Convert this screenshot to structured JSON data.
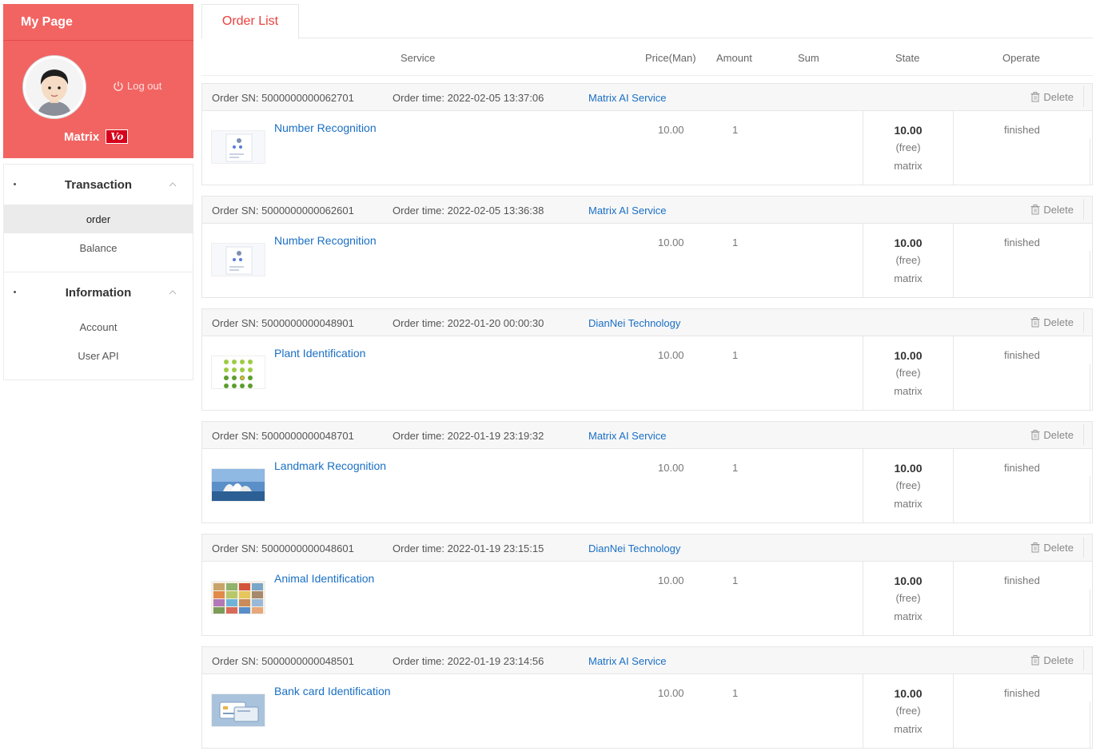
{
  "sidebar": {
    "title": "My Page",
    "logout_label": "Log out",
    "username": "Matrix",
    "vip_label": "Vo",
    "groups": [
      {
        "label": "Transaction",
        "items": [
          {
            "label": "order",
            "active": true
          },
          {
            "label": "Balance",
            "active": false
          }
        ]
      },
      {
        "label": "Information",
        "items": [
          {
            "label": "Account",
            "active": false
          },
          {
            "label": "User API",
            "active": false
          }
        ]
      }
    ]
  },
  "main": {
    "tab_label": "Order List",
    "columns": {
      "service": "Service",
      "price": "Price(Man)",
      "amount": "Amount",
      "sum": "Sum",
      "state": "State",
      "operate": "Operate"
    },
    "delete_label": "Delete",
    "orders": [
      {
        "sn_label": "Order SN:",
        "sn": "5000000000062701",
        "time_label": "Order time:",
        "time": "2022-02-05 13:37:06",
        "vendor": "Matrix AI Service",
        "service": "Number Recognition",
        "thumb": "number",
        "price": "10.00",
        "amount": "1",
        "sum": "10.00",
        "free": "(free)",
        "source": "matrix",
        "state": "finished"
      },
      {
        "sn_label": "Order SN:",
        "sn": "5000000000062601",
        "time_label": "Order time:",
        "time": "2022-02-05 13:36:38",
        "vendor": "Matrix AI Service",
        "service": "Number Recognition",
        "thumb": "number",
        "price": "10.00",
        "amount": "1",
        "sum": "10.00",
        "free": "(free)",
        "source": "matrix",
        "state": "finished"
      },
      {
        "sn_label": "Order SN:",
        "sn": "5000000000048901",
        "time_label": "Order time:",
        "time": "2022-01-20 00:00:30",
        "vendor": "DianNei Technology",
        "service": "Plant Identification",
        "thumb": "plant",
        "price": "10.00",
        "amount": "1",
        "sum": "10.00",
        "free": "(free)",
        "source": "matrix",
        "state": "finished"
      },
      {
        "sn_label": "Order SN:",
        "sn": "5000000000048701",
        "time_label": "Order time:",
        "time": "2022-01-19 23:19:32",
        "vendor": "Matrix AI Service",
        "service": "Landmark Recognition",
        "thumb": "landmark",
        "price": "10.00",
        "amount": "1",
        "sum": "10.00",
        "free": "(free)",
        "source": "matrix",
        "state": "finished"
      },
      {
        "sn_label": "Order SN:",
        "sn": "5000000000048601",
        "time_label": "Order time:",
        "time": "2022-01-19 23:15:15",
        "vendor": "DianNei Technology",
        "service": "Animal Identification",
        "thumb": "animal",
        "price": "10.00",
        "amount": "1",
        "sum": "10.00",
        "free": "(free)",
        "source": "matrix",
        "state": "finished"
      },
      {
        "sn_label": "Order SN:",
        "sn": "5000000000048501",
        "time_label": "Order time:",
        "time": "2022-01-19 23:14:56",
        "vendor": "Matrix AI Service",
        "service": "Bank card Identification",
        "thumb": "bankcard",
        "price": "10.00",
        "amount": "1",
        "sum": "10.00",
        "free": "(free)",
        "source": "matrix",
        "state": "finished"
      }
    ]
  },
  "colors": {
    "brand": "#f26462",
    "accent": "#e8413d",
    "link": "#1a6fc4",
    "vip": "#d6001c"
  }
}
